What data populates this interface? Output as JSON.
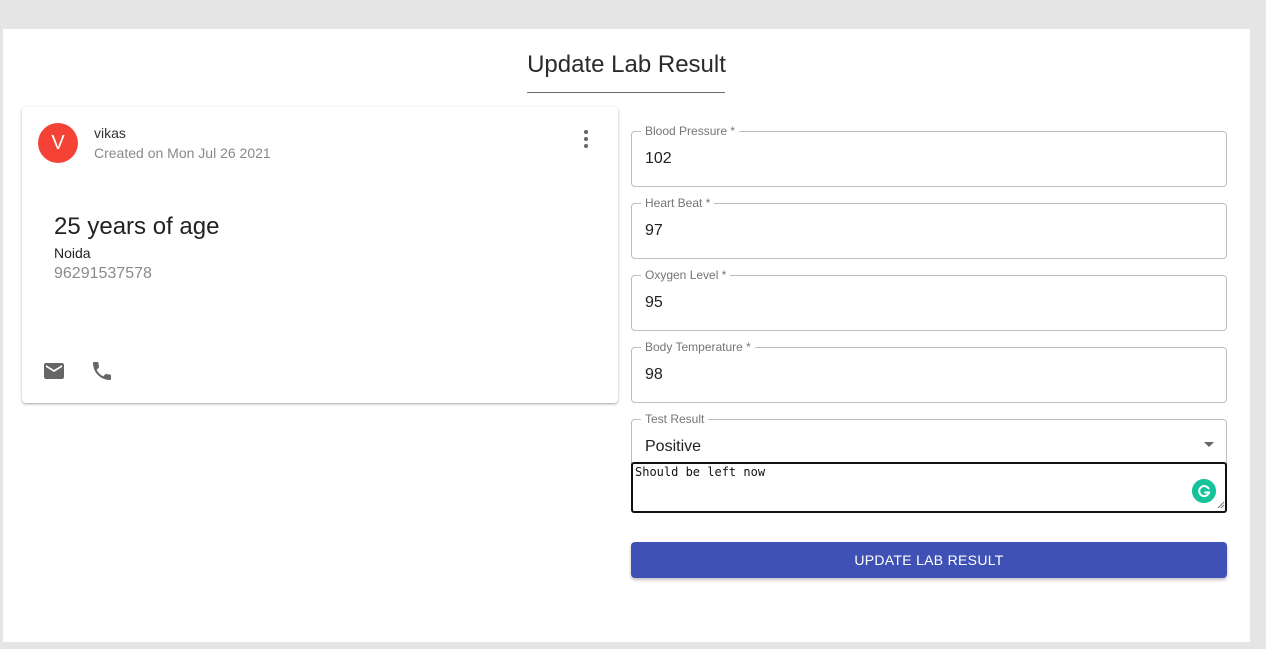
{
  "page": {
    "title": "Update Lab Result"
  },
  "card": {
    "avatar_letter": "V",
    "name": "vikas",
    "created": "Created on Mon Jul 26 2021",
    "age": "25 years of age",
    "city": "Noida",
    "phone": "96291537578",
    "icons": [
      "more-vert-icon",
      "mail-icon",
      "phone-icon"
    ],
    "avatar_color": "#f44336"
  },
  "form": {
    "fields": [
      {
        "label": "Blood Pressure *",
        "value": "102"
      },
      {
        "label": "Heart Beat *",
        "value": "97"
      },
      {
        "label": "Oxygen Level *",
        "value": "95"
      },
      {
        "label": "Body Temperature *",
        "value": "98"
      }
    ],
    "test_result": {
      "label": "Test Result",
      "value": "Positive"
    },
    "notes": "Should be left now",
    "submit_label": "UPDATE LAB RESULT",
    "button_color": "#3f51b5"
  }
}
